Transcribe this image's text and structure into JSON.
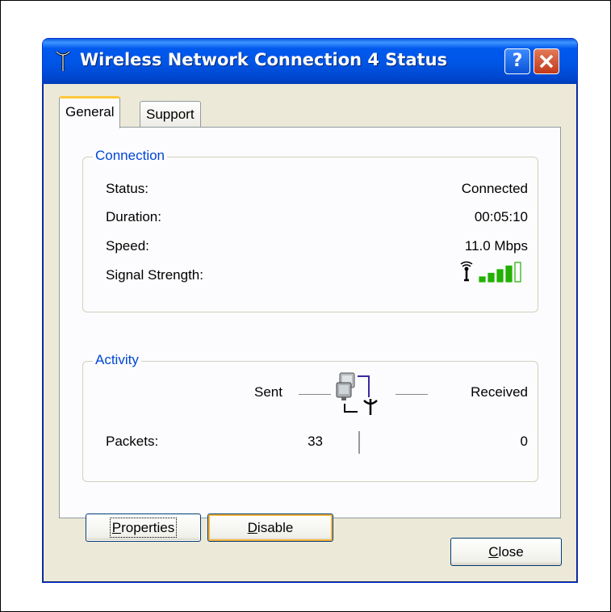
{
  "window": {
    "title": "Wireless Network Connection 4 Status",
    "help_glyph": "?"
  },
  "tabs": [
    {
      "label": "General"
    },
    {
      "label": "Support"
    }
  ],
  "connection": {
    "group_title": "Connection",
    "status_label": "Status:",
    "status_value": "Connected",
    "duration_label": "Duration:",
    "duration_value": "00:05:10",
    "speed_label": "Speed:",
    "speed_value": "11.0 Mbps",
    "signal_label": "Signal Strength:",
    "signal_bars_lit": 4,
    "signal_bars_total": 5
  },
  "activity": {
    "group_title": "Activity",
    "sent_label": "Sent",
    "received_label": "Received",
    "packets_label": "Packets:",
    "packets_sent": "33",
    "packets_received": "0"
  },
  "buttons": {
    "properties_rest": "roperties",
    "properties_key": "P",
    "disable_rest": "isable",
    "disable_key": "D",
    "close_rest": "lose",
    "close_key": "C"
  },
  "colors": {
    "accent": "#0046d5",
    "title_bar": "#0055e5",
    "signal_green": "#22b100"
  }
}
